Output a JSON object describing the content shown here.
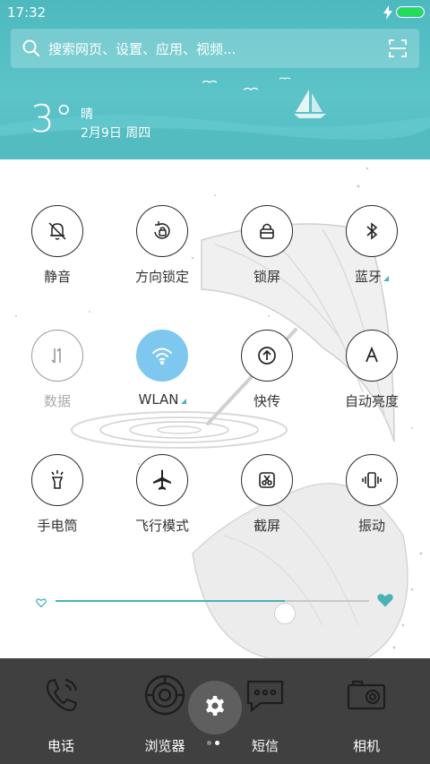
{
  "status_bar": {
    "time": "17:32"
  },
  "search": {
    "placeholder": "搜索网页、设置、应用、视频..."
  },
  "weather": {
    "temperature": "3°",
    "condition": "晴",
    "date": "2月9日 周四"
  },
  "toggles": [
    {
      "label": "静音",
      "icon": "bell-off-icon",
      "state": "off"
    },
    {
      "label": "方向锁定",
      "icon": "rotation-lock-icon",
      "state": "off"
    },
    {
      "label": "锁屏",
      "icon": "lock-icon",
      "state": "off"
    },
    {
      "label": "蓝牙",
      "icon": "bluetooth-icon",
      "state": "off",
      "has_more": true
    },
    {
      "label": "数据",
      "icon": "mobile-data-icon",
      "state": "disabled"
    },
    {
      "label": "WLAN",
      "icon": "wifi-icon",
      "state": "on",
      "has_more": true
    },
    {
      "label": "快传",
      "icon": "quick-transfer-icon",
      "state": "off"
    },
    {
      "label": "自动亮度",
      "icon": "auto-brightness-icon",
      "state": "off"
    },
    {
      "label": "手电筒",
      "icon": "flashlight-icon",
      "state": "off"
    },
    {
      "label": "飞行模式",
      "icon": "airplane-icon",
      "state": "off"
    },
    {
      "label": "截屏",
      "icon": "screenshot-icon",
      "state": "off"
    },
    {
      "label": "振动",
      "icon": "vibrate-icon",
      "state": "off"
    }
  ],
  "brightness": {
    "level": 0.73
  },
  "dock": {
    "items": [
      {
        "label": "电话",
        "icon": "phone-icon"
      },
      {
        "label": "浏览器",
        "icon": "browser-icon"
      },
      {
        "label": "短信",
        "icon": "message-icon"
      },
      {
        "label": "相机",
        "icon": "camera-icon"
      }
    ],
    "settings_icon": "gear-icon",
    "page_count": 2,
    "active_page": 2
  },
  "colors": {
    "header": "#5cc4c9",
    "accent": "#47b3b6",
    "toggle_on": "#7ec8f0",
    "dock_bg": "#404040",
    "battery": "#22dd55"
  }
}
